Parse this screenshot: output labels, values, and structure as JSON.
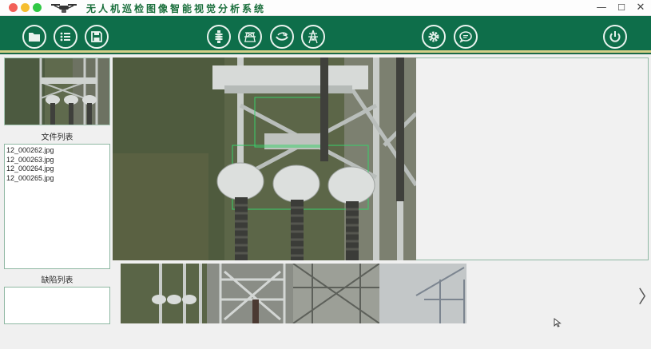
{
  "app": {
    "title": "无人机巡检图像智能视觉分析系统"
  },
  "window_controls": {
    "minimize": "—",
    "maximize": "☐",
    "close": "✕"
  },
  "toolbar": {
    "left_buttons": [
      "folder-icon",
      "list-icon",
      "save-icon"
    ],
    "center_buttons": [
      "insulator-icon",
      "tower-frame-icon",
      "bird-nest-icon",
      "transmission-tower-icon"
    ],
    "right_buttons": [
      "gear-icon",
      "chat-icon"
    ],
    "power_button": "power-icon",
    "colors": {
      "bar": "#0e6e4a",
      "stripe": "#d4cf88",
      "icon": "#e9f3ee"
    }
  },
  "sidebar": {
    "file_list_label": "文件列表",
    "files": [
      "12_000262.jpg",
      "12_000263.jpg",
      "12_000264.jpg",
      "12_000265.jpg"
    ],
    "defect_list_label": "缺陷列表",
    "defects": []
  },
  "gallery": {
    "prev": "〈",
    "next": "〉"
  }
}
